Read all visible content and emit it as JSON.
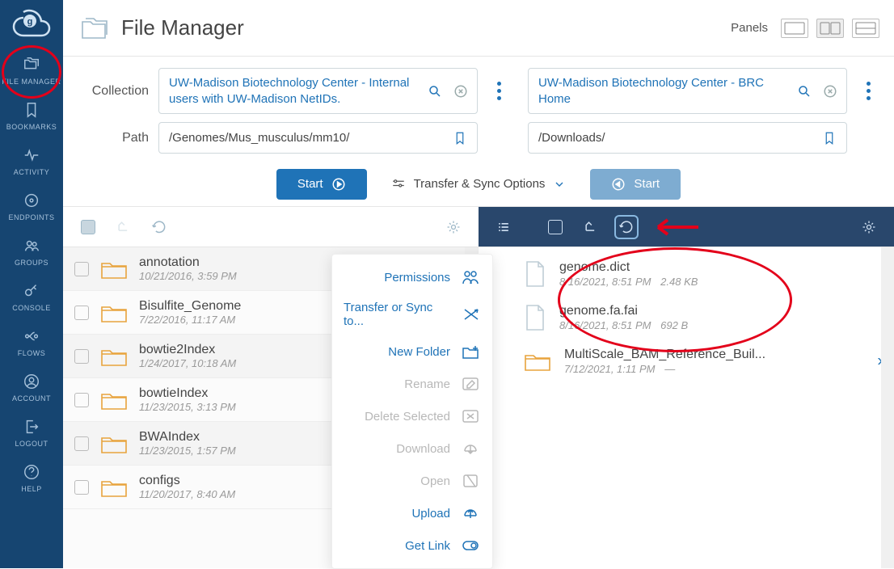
{
  "app": {
    "title": "File Manager",
    "panels_label": "Panels"
  },
  "sidebar": {
    "items": [
      {
        "label": "FILE MANAGER"
      },
      {
        "label": "BOOKMARKS"
      },
      {
        "label": "ACTIVITY"
      },
      {
        "label": "ENDPOINTS"
      },
      {
        "label": "GROUPS"
      },
      {
        "label": "CONSOLE"
      },
      {
        "label": "FLOWS"
      },
      {
        "label": "ACCOUNT"
      },
      {
        "label": "LOGOUT"
      },
      {
        "label": "HELP"
      }
    ]
  },
  "collection": {
    "label": "Collection",
    "left": "UW-Madison Biotechnology Center - Internal users with UW-Madison NetIDs.",
    "right": "UW-Madison Biotechnology Center - BRC Home"
  },
  "path": {
    "label": "Path",
    "left": "/Genomes/Mus_musculus/mm10/",
    "right": "/Downloads/"
  },
  "actions": {
    "start_left": "Start",
    "tso": "Transfer & Sync Options",
    "start_right": "Start"
  },
  "menu": [
    {
      "label": "Permissions",
      "enabled": true
    },
    {
      "label": "Transfer or Sync to...",
      "enabled": true
    },
    {
      "label": "New Folder",
      "enabled": true
    },
    {
      "label": "Rename",
      "enabled": false
    },
    {
      "label": "Delete Selected",
      "enabled": false
    },
    {
      "label": "Download",
      "enabled": false
    },
    {
      "label": "Open",
      "enabled": false
    },
    {
      "label": "Upload",
      "enabled": true
    },
    {
      "label": "Get Link",
      "enabled": true
    }
  ],
  "left_files": [
    {
      "name": "annotation",
      "date": "10/21/2016, 3:59 PM",
      "size": "—",
      "type": "folder"
    },
    {
      "name": "Bisulfite_Genome",
      "date": "7/22/2016, 11:17 AM",
      "size": "—",
      "type": "folder"
    },
    {
      "name": "bowtie2Index",
      "date": "1/24/2017, 10:18 AM",
      "size": "—",
      "type": "folder"
    },
    {
      "name": "bowtieIndex",
      "date": "11/23/2015, 3:13 PM",
      "size": "—",
      "type": "folder"
    },
    {
      "name": "BWAIndex",
      "date": "11/23/2015, 1:57 PM",
      "size": "—",
      "type": "folder"
    },
    {
      "name": "configs",
      "date": "11/20/2017, 8:40 AM",
      "size": "—",
      "type": "folder"
    }
  ],
  "right_files": [
    {
      "name": "genome.dict",
      "date": "8/16/2021, 8:51 PM",
      "size": "2.48 KB",
      "type": "file"
    },
    {
      "name": "genome.fa.fai",
      "date": "8/16/2021, 8:51 PM",
      "size": "692 B",
      "type": "file"
    },
    {
      "name": "MultiScale_BAM_Reference_Buil...",
      "date": "7/12/2021, 1:11 PM",
      "size": "—",
      "type": "folder"
    }
  ]
}
